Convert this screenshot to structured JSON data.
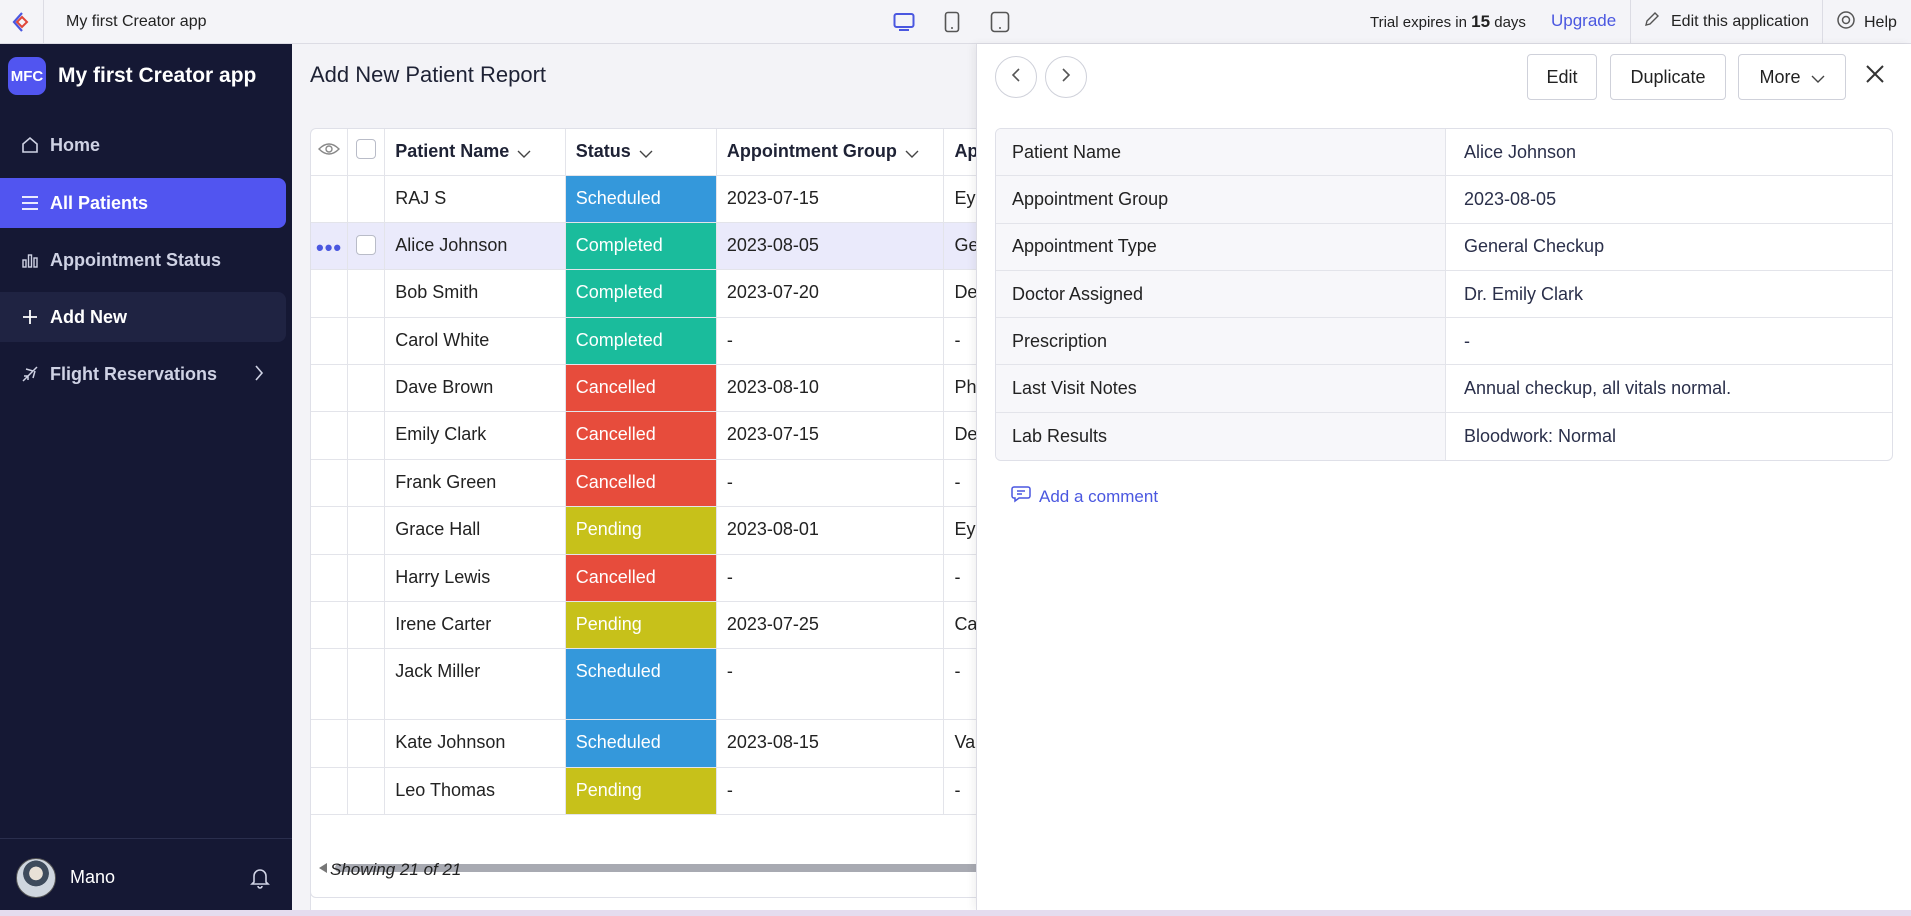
{
  "topbar": {
    "app_title": "My first Creator app",
    "trial_prefix": "Trial expires in",
    "trial_days": "15",
    "trial_suffix": "days",
    "upgrade_label": "Upgrade",
    "edit_app_label": "Edit this application",
    "help_label": "Help",
    "devices": [
      "desktop-icon",
      "tablet-icon",
      "mobile-icon"
    ]
  },
  "sidebar": {
    "badge": "MFC",
    "app_name": "My first Creator app",
    "items": [
      {
        "label": "Home",
        "icon": "home-icon"
      },
      {
        "label": "All Patients",
        "icon": "list-icon"
      },
      {
        "label": "Appointment Status",
        "icon": "bar-chart-icon"
      },
      {
        "label": "Add New",
        "icon": "plus-icon"
      },
      {
        "label": "Flight Reservations",
        "icon": "plane-icon"
      }
    ],
    "user_name": "Mano"
  },
  "report": {
    "title": "Add New Patient Report",
    "columns": [
      "Patient Name",
      "Status",
      "Appointment Group",
      "Ap"
    ],
    "rows": [
      {
        "name": "RAJ S",
        "status": "Scheduled",
        "group": "2023-07-15",
        "type": "Ey"
      },
      {
        "name": "Alice Johnson",
        "status": "Completed",
        "group": "2023-08-05",
        "type": "Ge"
      },
      {
        "name": "Bob Smith",
        "status": "Completed",
        "group": "2023-07-20",
        "type": "De"
      },
      {
        "name": "Carol White",
        "status": "Completed",
        "group": "-",
        "type": "-"
      },
      {
        "name": "Dave Brown",
        "status": "Cancelled",
        "group": "2023-08-10",
        "type": "Ph"
      },
      {
        "name": "Emily Clark",
        "status": "Cancelled",
        "group": "2023-07-15",
        "type": "De"
      },
      {
        "name": "Frank Green",
        "status": "Cancelled",
        "group": "-",
        "type": "-"
      },
      {
        "name": "Grace Hall",
        "status": "Pending",
        "group": "2023-08-01",
        "type": "Ey"
      },
      {
        "name": "Harry Lewis",
        "status": "Cancelled",
        "group": "-",
        "type": "-"
      },
      {
        "name": "Irene Carter",
        "status": "Pending",
        "group": "2023-07-25",
        "type": "Ca"
      },
      {
        "name": "Jack Miller",
        "status": "Scheduled",
        "group": "-",
        "type": "-"
      },
      {
        "name": "Kate Johnson",
        "status": "Scheduled",
        "group": "2023-08-15",
        "type": "Va"
      },
      {
        "name": "Leo Thomas",
        "status": "Pending",
        "group": "-",
        "type": "-"
      }
    ],
    "showing": "Showing 21 of 21",
    "status_colors": {
      "Scheduled": "#3498db",
      "Completed": "#1abc9c",
      "Cancelled": "#e74c3c",
      "Pending": "#c7c11a"
    }
  },
  "detail": {
    "buttons": {
      "edit": "Edit",
      "duplicate": "Duplicate",
      "more": "More"
    },
    "fields": [
      {
        "label": "Patient Name",
        "value": "Alice Johnson"
      },
      {
        "label": "Appointment Group",
        "value": "2023-08-05"
      },
      {
        "label": "Appointment Type",
        "value": "General Checkup"
      },
      {
        "label": "Doctor Assigned",
        "value": "Dr. Emily Clark"
      },
      {
        "label": "Prescription",
        "value": "-"
      },
      {
        "label": "Last Visit Notes",
        "value": "Annual checkup, all vitals normal."
      },
      {
        "label": "Lab Results",
        "value": "Bloodwork: Normal"
      }
    ],
    "add_comment": "Add a comment"
  }
}
